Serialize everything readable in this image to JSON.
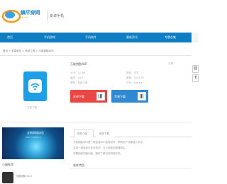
{
  "header": {
    "logo_text": "鎮平穿网",
    "logo_sub": "CHUKI",
    "channel": "安卓手机"
  },
  "nav": {
    "items": [
      "首页",
      "手机游戏",
      "手机软件",
      "最新资讯",
      "专题合集"
    ]
  },
  "breadcrumb": "首页 > 安卓软件 > 系统工具 > 万能钥匙WiFi",
  "side_tools": [
    "回",
    "卡"
  ],
  "app": {
    "title": "万能钥匙WiFi",
    "title_right": "分享",
    "icon_caption": "立即下载",
    "meta": [
      "大小：12.5M",
      "版本：V4.5",
      "类型：系统工具",
      "语言：中文",
      "更新：2023-01",
      "评分：★★★★"
    ],
    "download_android": "安卓下载",
    "download_ios": "苹果下载"
  },
  "banner": {
    "title": "全新网络体验",
    "subtitle": "WIFI CONNECT",
    "caption": "小编推荐"
  },
  "related": {
    "label": "万能钥匙 V4.5"
  },
  "tabs": [
    "软件介绍",
    "相关下载"
  ],
  "description": [
    "万能钥匙WiFi是一款免费WiFi连接软件，帮助用户快速接入热点。",
    "支持一键连接与安全检测，让上网更加便捷稳定。",
    "内置网络测速功能，随时了解当前网络状况。"
  ],
  "section_head": "软件特色"
}
